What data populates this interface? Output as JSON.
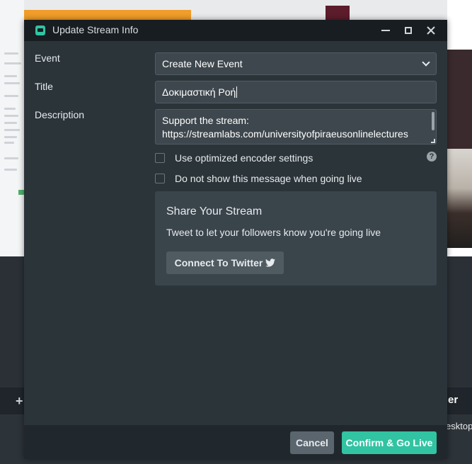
{
  "window": {
    "title": "Update Stream Info",
    "minimize_icon": "minimize-icon",
    "maximize_icon": "maximize-icon",
    "close_icon": "close-icon"
  },
  "form": {
    "event_label": "Event",
    "event_value": "Create New Event",
    "title_label": "Title",
    "title_value": "Δοκιμαστική Ροή",
    "description_label": "Description",
    "description_line1": "Support the stream:",
    "description_line2": "https://streamlabs.com/universityofpiraeusonlinelectures",
    "optimized_label": "Use optimized encoder settings",
    "optimized_checked": false,
    "dont_show_label": "Do not show this message when going live",
    "dont_show_checked": false,
    "help_glyph": "?"
  },
  "share": {
    "title": "Share Your Stream",
    "subtitle": "Tweet to let your followers know you're going live",
    "twitter_button": "Connect To Twitter"
  },
  "footer": {
    "cancel_label": "Cancel",
    "confirm_label": "Confirm & Go Live"
  },
  "background": {
    "plus_glyph": "+",
    "right_label_1": "er",
    "right_label_2": "esktop"
  },
  "colors": {
    "accent": "#31c3a2",
    "dialog_bg": "#2b3439",
    "titlebar_bg": "#171d21",
    "panel_bg": "#3a444b"
  }
}
